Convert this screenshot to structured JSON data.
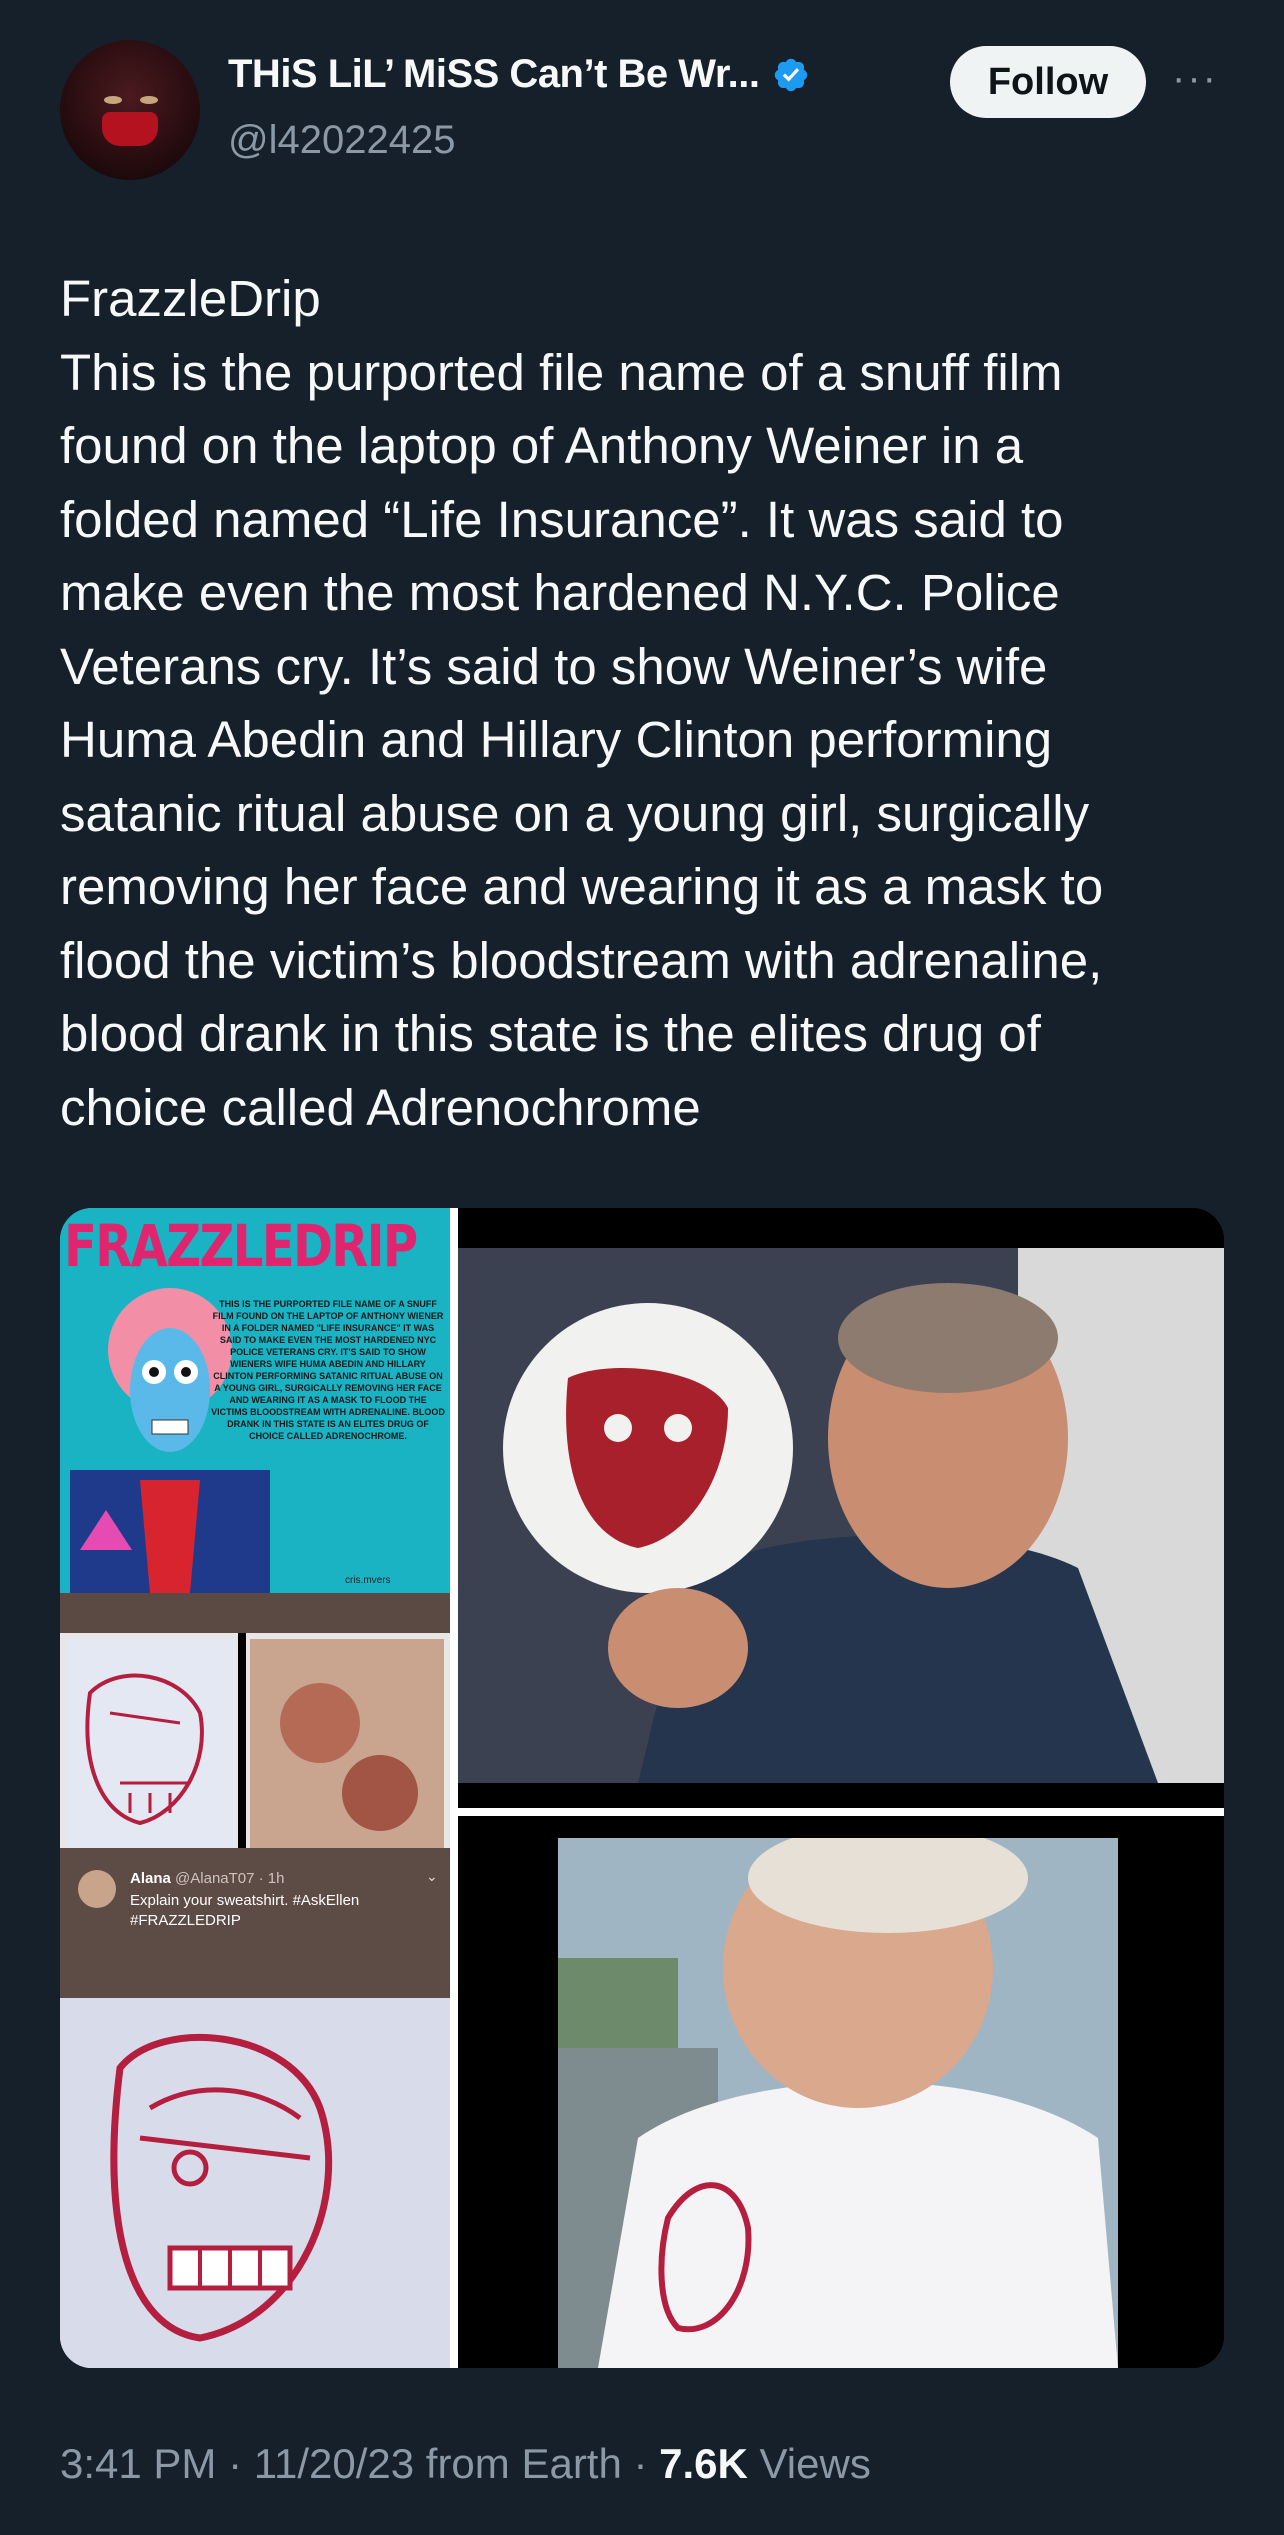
{
  "author": {
    "display_name": "THiS LiL’ MiSS Can’t Be Wr...",
    "handle": "@l42022425",
    "verified": true
  },
  "follow_label": "Follow",
  "more_label": "···",
  "tweet_text": "FrazzleDrip\nThis is the purported file name of a snuff film\nfound on the laptop of Anthony Weiner in a\nfolded named “Life Insurance”. It was said to\nmake even the most hardened N.Y.C. Police\nVeterans cry. It’s said to show Weiner’s wife\nHuma Abedin and Hillary Clinton performing\nsatanic ritual abuse on a young girl, surgically\nremoving her face and wearing it as a mask to\nflood the victim’s bloodstream  with adrenaline,\nblood drank in this state is the elites drug of\nchoice called  Adrenochrome",
  "media": {
    "poster_title": "FRAZZLEDRIP",
    "poster_text": "THIS IS THE PURPORTED FILE NAME OF A SNUFF FILM FOUND ON THE LAPTOP OF ANTHONY WIENER IN A FOLDER NAMED \"LIFE INSURANCE\" IT WAS SAID TO MAKE EVEN THE MOST HARDENED NYC POLICE VETERANS CRY. IT'S SAID TO SHOW WIENERS WIFE HUMA ABEDIN AND HILLARY CLINTON PERFORMING SATANIC RITUAL ABUSE ON A YOUNG GIRL, SURGICALLY REMOVING HER FACE AND WEARING IT AS A MASK TO FLOOD THE VICTIMS BLOODSTREAM WITH ADRENALINE. BLOOD DRANK IN THIS STATE IS AN ELITES DRUG OF CHOICE CALLED ADRENOCHROME.",
    "poster_credit": "cris.mvers",
    "embedded_tweet": {
      "name": "Alana",
      "handle_time": "@AlanaT07 · 1h",
      "text": "Explain your sweatshirt. #AskEllen",
      "hashtag": "#FRAZZLEDRIP"
    }
  },
  "meta": {
    "time_date": "3:41 PM · 11/20/23 from Earth · ",
    "views_count": "7.6K",
    "views_label": " Views"
  },
  "colors": {
    "background": "#15202b",
    "secondary_text": "#8b98a5",
    "verified_blue": "#1d9bf0",
    "poster_pink": "#e0256e",
    "poster_cyan": "#1ab3c4"
  }
}
